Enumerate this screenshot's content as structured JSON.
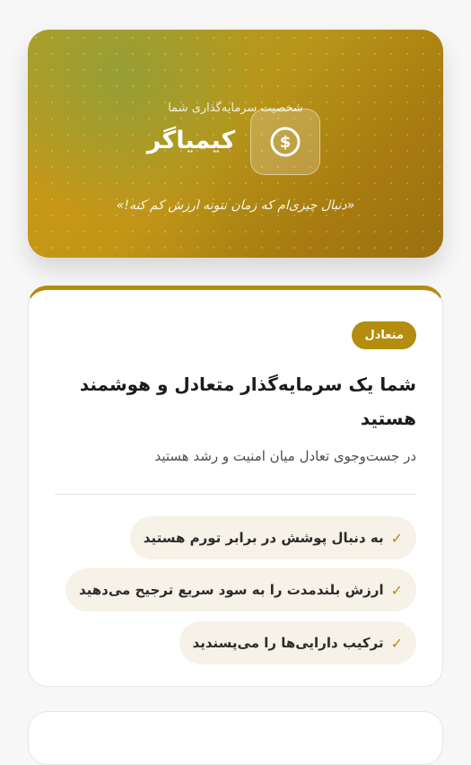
{
  "hero": {
    "subtitle": "شخصیت سرمایه‌گذاری شما",
    "title": "کیمیاگر",
    "icon": "coin-icon",
    "quote": "«دنبال چیزی‌ام که زمان نتونه ارزش کم کنه!»"
  },
  "profile": {
    "badge": "متعادل",
    "title": "شما یک سرمایه‌گذار متعادل و هوشمند هستید",
    "description": "در جست‌وجوی تعادل میان امنیت و رشد هستید",
    "traits": [
      {
        "label": "به دنبال پوشش در برابر تورم هستید",
        "check": "✓"
      },
      {
        "label": "ارزش بلندمدت را به سود سریع ترجیح می‌دهید",
        "check": "✓"
      },
      {
        "label": "ترکیب دارایی‌ها را می‌پسندید",
        "check": "✓"
      }
    ]
  },
  "colors": {
    "accent": "#b48c10",
    "trait_background": "#f6f2e7"
  }
}
